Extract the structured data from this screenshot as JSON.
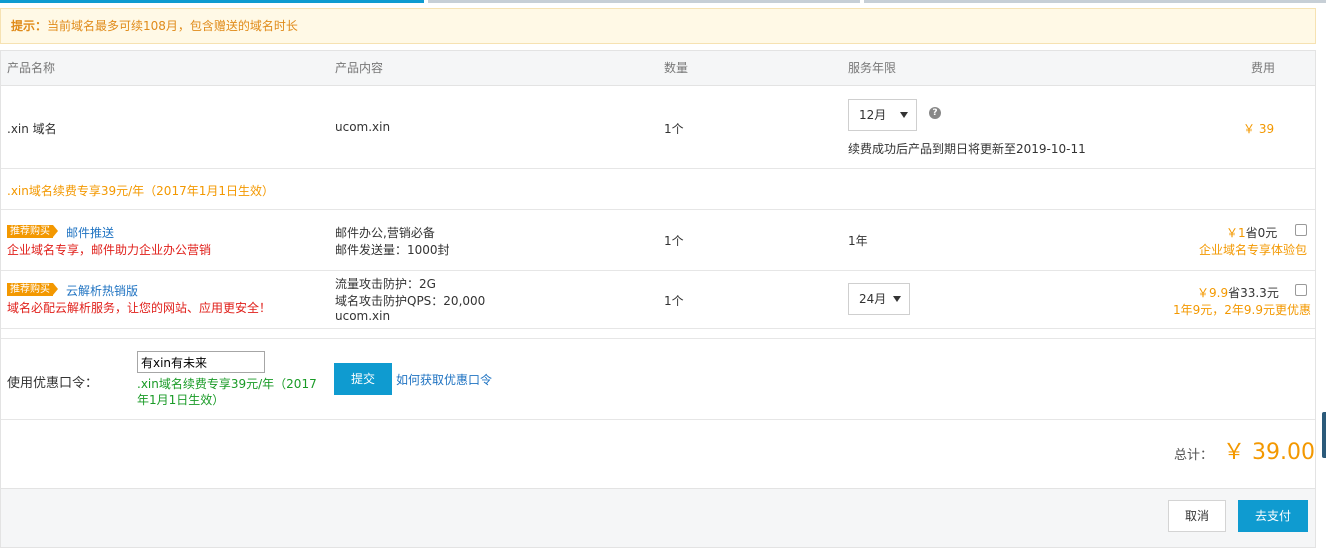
{
  "notice": {
    "lead": "提示：",
    "text": "当前域名最多可续108月，包含赠送的域名时长"
  },
  "table": {
    "headers": [
      "产品名称",
      "产品内容",
      "数量",
      "服务年限",
      "费用"
    ],
    "domain_row": {
      "name": ".xin 域名",
      "content": "ucom.xin",
      "qty": "1个",
      "term_selected": "12月",
      "help": "?",
      "expire_note": "续费成功后产品到期日将更新至2019-10-11",
      "price": "￥ 39"
    },
    "promo_line": ".xin域名续费专享39元/年（2017年1月1日生效）",
    "mail_row": {
      "badge": "推荐购买",
      "name": "邮件推送",
      "subtitle": "企业域名专享，邮件助力企业办公营销",
      "content_lines": [
        "邮件办公,营销必备",
        "邮件发送量：1000封"
      ],
      "qty": "1个",
      "term": "1年",
      "price": "￥1",
      "saving": "省0元",
      "note": "企业域名专享体验包"
    },
    "dns_row": {
      "badge": "推荐购买",
      "name": "云解析热销版",
      "subtitle": "域名必配云解析服务，让您的网站、应用更安全！",
      "content_lines": [
        "流量攻击防护：2G",
        "域名攻击防护QPS：20,000",
        "ucom.xin"
      ],
      "qty": "1个",
      "term_selected": "24月",
      "price": "￥9.9",
      "saving": "省33.3元",
      "note": "1年9元，2年9.9元更优惠"
    }
  },
  "coupon": {
    "label": "使用优惠口令：",
    "value": "有xin有未来",
    "hint": ".xin域名续费专享39元/年（2017年1月1日生效）",
    "submit": "提交",
    "link": "如何获取优惠口令"
  },
  "summary": {
    "total_label": "总计：",
    "total_value": "￥ 39.00"
  },
  "footer": {
    "cancel": "取消",
    "pay": "去支付"
  },
  "colors": {
    "accent": "#f39800",
    "primary_button": "#0f9bd0",
    "warning": "#e0201b",
    "link": "#1f73c2",
    "success": "#1a9b27"
  }
}
